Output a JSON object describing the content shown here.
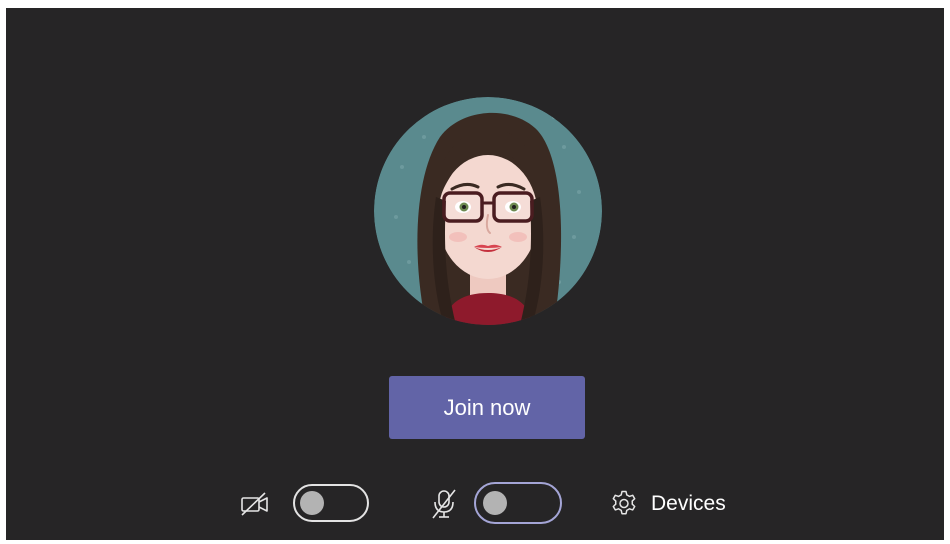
{
  "window": {
    "background": "#262526"
  },
  "avatar": {
    "icon": "user-avatar-image",
    "bg_color": "#5a8a8e"
  },
  "join": {
    "label": "Join now",
    "color": "#6264a7"
  },
  "controls": {
    "camera": {
      "icon": "camera-off-icon",
      "state": "off"
    },
    "microphone": {
      "icon": "mic-off-icon",
      "state": "off"
    },
    "devices": {
      "icon": "gear-icon",
      "label": "Devices"
    }
  }
}
